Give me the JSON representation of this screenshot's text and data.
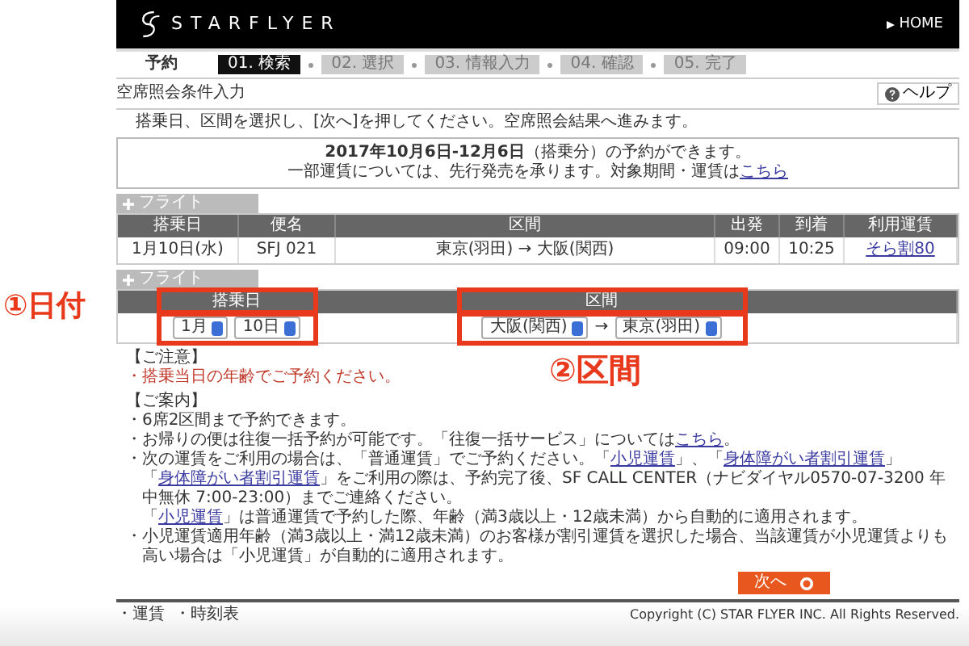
{
  "header": {
    "logo": "STARFLYER",
    "home_link": "HOME"
  },
  "steps": {
    "label": "予約",
    "items": [
      {
        "label": "01. 検索",
        "selected": true
      },
      {
        "label": "02. 選択",
        "selected": false
      },
      {
        "label": "03. 情報入力",
        "selected": false
      },
      {
        "label": "04. 確認",
        "selected": false
      },
      {
        "label": "05. 完了",
        "selected": false
      }
    ]
  },
  "page_title": "空席照会条件入力",
  "help_button": "ヘルプ",
  "instruction": "搭乗日、区間を選択し、[次へ]を押してください。空席照会結果へ進みます。",
  "notice": {
    "line_1": "**2017年10月6日-12月6日**（搭乗分）の予約ができます。",
    "line_2": "一部運賃については、先行発売を承ります。対象期間・運賃は",
    "link": "こちら"
  },
  "selected_flight": {
    "section_label": "フライト",
    "columns": [
      "搭乗日",
      "便名",
      "区間",
      "出発",
      "到着",
      "利用運賃"
    ],
    "row": [
      "1月10日(水)",
      "SFJ 021",
      "東京(羽田) → 大阪(関西)",
      "09:00",
      "10:25",
      "そら割80"
    ]
  },
  "flight_search": {
    "section_label": "フライト",
    "date_column": {
      "label": "搭乗日",
      "highlighted": true,
      "month": "1月",
      "day": "10日"
    },
    "route_column": {
      "label": "区間",
      "highlighted": true,
      "from": "大阪(関西)",
      "arrow": "→",
      "to": "東京(羽田)"
    }
  },
  "annotations": [
    {
      "label": "①日付"
    },
    {
      "label": "②区間"
    }
  ],
  "caution": {
    "heading": "【ご注意】",
    "items": [
      "・搭乗当日の年齢でご予約ください。"
    ]
  },
  "guide": {
    "heading": "【ご案内】",
    "items": [
      {
        "bullet": "・",
        "paragraphs": [
          [
            {
              "text": "6席2区間まで予約できます。",
              "link": false
            }
          ]
        ]
      },
      {
        "bullet": "・",
        "paragraphs": [
          [
            {
              "text": "お帰りの便は往復一括予約が可能です。「往復一括サービス」については",
              "link": false
            },
            {
              "text": "こちら",
              "link": true
            },
            {
              "text": "。",
              "link": false
            }
          ]
        ]
      },
      {
        "bullet": "・",
        "paragraphs": [
          [
            {
              "text": "次の運賃をご利用の場合は、「普通運賃」でご予約ください。「",
              "link": false
            },
            {
              "text": "小児運賃",
              "link": true
            },
            {
              "text": "」、「",
              "link": false
            },
            {
              "text": "身体障がい者割引運賃",
              "link": true
            },
            {
              "text": "」",
              "link": false
            }
          ],
          [
            {
              "text": "「",
              "link": false
            },
            {
              "text": "身体障がい者割引運賃",
              "link": true
            },
            {
              "text": "」をご利用の際は、予約完了後、SF CALL CENTER（ナビダイヤル0570-07-3200 年中無休 7:00-23:00）までご連絡ください。",
              "link": false
            }
          ],
          [
            {
              "text": "「",
              "link": false
            },
            {
              "text": "小児運賃",
              "link": true
            },
            {
              "text": "」は普通運賃で予約した際、年齢（満3歳以上・12歳未満）から自動的に適用されます。",
              "link": false
            }
          ]
        ]
      },
      {
        "bullet": "・",
        "paragraphs": [
          [
            {
              "text": "小児運賃適用年齢（満3歳以上・満12歳未満）のお客様が割引運賃を選択した場合、当該運賃が小児運賃よりも高い場合は「小児運賃」が自動的に適用されます。",
              "link": false
            }
          ]
        ]
      }
    ]
  },
  "next_button": "次へ",
  "footer": {
    "links": [
      "・運賃",
      "・時刻表"
    ],
    "copyright": "Copyright (C) STAR FLYER INC. All Rights Reserved."
  }
}
